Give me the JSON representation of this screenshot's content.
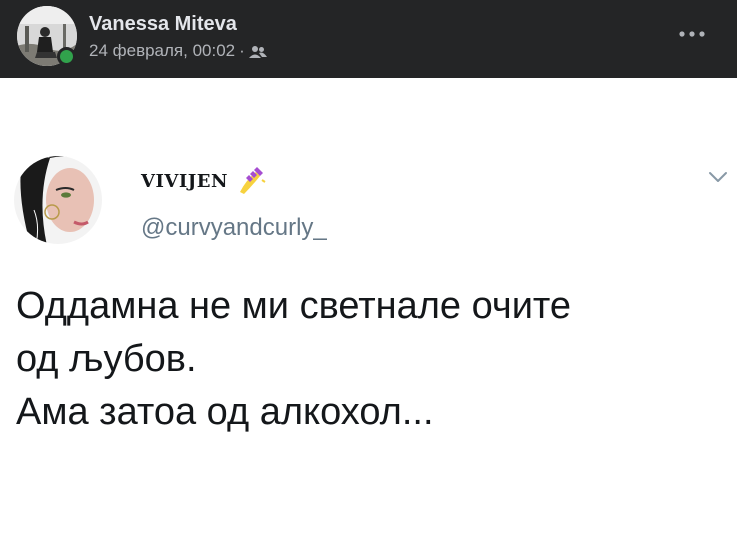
{
  "post": {
    "author_name": "Vanessa Miteva",
    "timestamp": "24 февраля, 00:02",
    "separator": "·",
    "audience_icon": "friends-icon",
    "more_icon": "more-dots-icon",
    "header_bg": "#242526",
    "online_color": "#31a24c"
  },
  "tweet": {
    "display_name": "VIVIJEN",
    "name_emoji": "nail-polish-emoji",
    "handle": "@curvyandcurly_",
    "menu_icon": "chevron-down-icon",
    "lines": [
      "Оддамна не ми светнале очите",
      "од љубов.",
      "Ама затоа од алкохол..."
    ]
  }
}
